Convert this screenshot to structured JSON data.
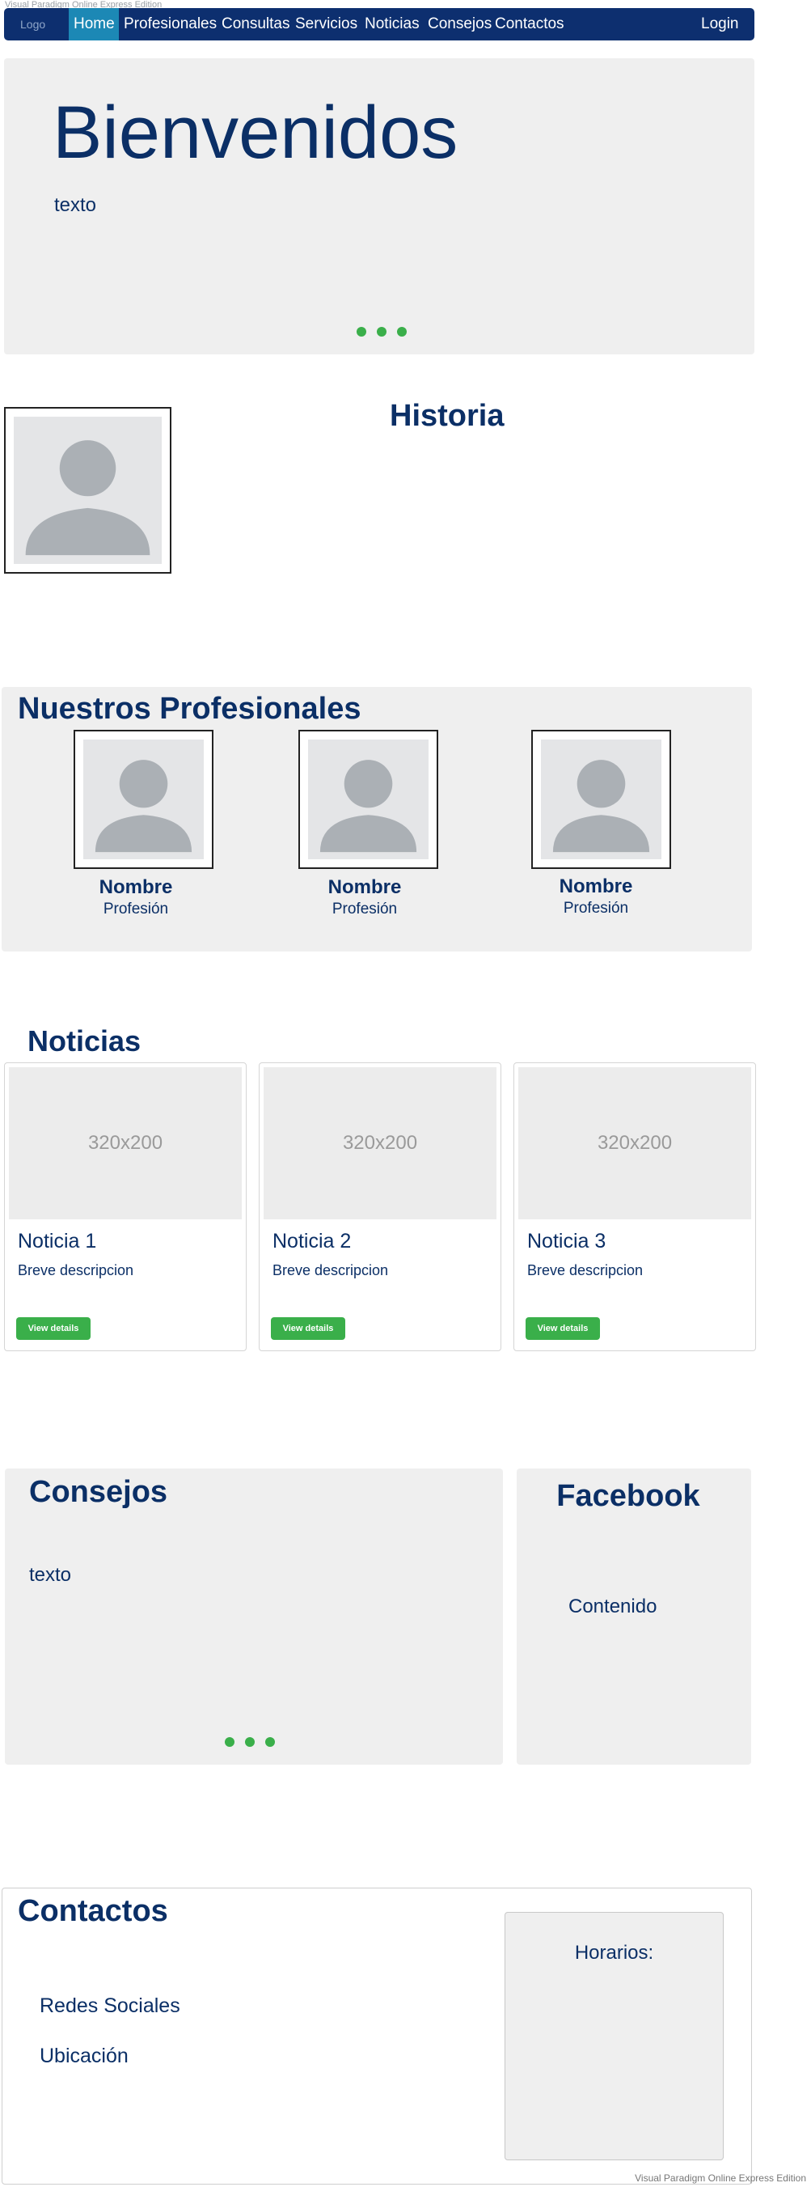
{
  "watermark": "Visual Paradigm Online Express Edition",
  "nav": {
    "logo": "Logo",
    "items": [
      "Home",
      "Profesionales",
      "Consultas",
      "Servicios",
      "Noticias",
      "Consejos",
      "Contactos"
    ],
    "login": "Login",
    "active_index": 0
  },
  "hero": {
    "title": "Bienvenidos",
    "text": "texto",
    "carousel_dots": 3
  },
  "historia": {
    "title": "Historia"
  },
  "profesionales": {
    "title": "Nuestros Profesionales",
    "items": [
      {
        "name": "Nombre",
        "role": "Profesión"
      },
      {
        "name": "Nombre",
        "role": "Profesión"
      },
      {
        "name": "Nombre",
        "role": "Profesión"
      }
    ]
  },
  "noticias": {
    "title": "Noticias",
    "items": [
      {
        "image": "320x200",
        "title": "Noticia 1",
        "desc": "Breve descripcion",
        "button": "View details"
      },
      {
        "image": "320x200",
        "title": "Noticia 2",
        "desc": "Breve descripcion",
        "button": "View details"
      },
      {
        "image": "320x200",
        "title": "Noticia 3",
        "desc": "Breve descripcion",
        "button": "View details"
      }
    ]
  },
  "consejos": {
    "title": "Consejos",
    "text": "texto",
    "carousel_dots": 3
  },
  "facebook": {
    "title": "Facebook",
    "content": "Contenido"
  },
  "contactos": {
    "title": "Contactos",
    "links": [
      "Redes Sociales",
      "Ubicación"
    ],
    "horarios": "Horarios:"
  },
  "colors": {
    "navbar": "#0d2f6f",
    "nav_active": "#1c88b5",
    "accent_green": "#3aaf4a",
    "text_dark_blue": "#0b2f66",
    "panel_gray": "#efefef"
  }
}
